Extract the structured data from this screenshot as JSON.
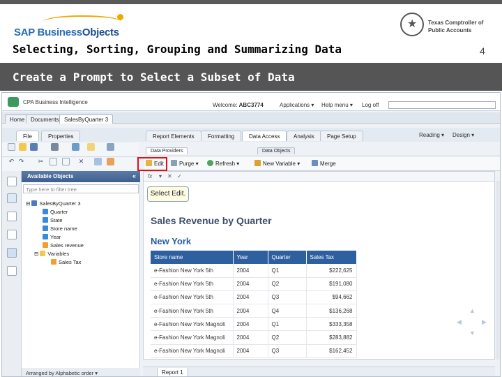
{
  "slide": {
    "logo_prefix": "SAP Business",
    "logo_suffix": "Objects",
    "org_line1": "Texas Comptroller of",
    "org_line2": "Public Accounts",
    "title": "Selecting, Sorting, Grouping and Summarizing Data",
    "page_number": "4",
    "banner": "Create a Prompt to Select a Subset of Data"
  },
  "app": {
    "title": "CPA Business Intelligence",
    "welcome_label": "Welcome:",
    "user": "ABC3774",
    "links": [
      "Applications ▾",
      "Help menu ▾",
      "Log off"
    ],
    "doc_tabs": [
      "Home",
      "Documents",
      "SalesByQuarter 3"
    ],
    "main_tabs": [
      "File",
      "Properties"
    ],
    "report_tabs": [
      "Report Elements",
      "Formatting",
      "Data Access",
      "Analysis",
      "Page Setup"
    ],
    "view_modes": [
      "Reading ▾",
      "Design ▾"
    ],
    "sub_tabs": [
      "Data Providers",
      "Data Objects"
    ],
    "ribbon": {
      "edit": "Edit",
      "purge": "Purge",
      "refresh": "Refresh",
      "new_variable": "New Variable",
      "merge": "Merge"
    },
    "callout": "Select Edit.",
    "panel": {
      "title": "Available Objects",
      "filter_placeholder": "Type here to filter tree",
      "tree": [
        "SalesByQuarter 3",
        "Quarter",
        "State",
        "Store name",
        "Year",
        "Sales revenue",
        "Variables",
        "Sales Tax"
      ],
      "footer": "Arranged by Alphabetic order ▾"
    },
    "report": {
      "title": "Sales Revenue by Quarter",
      "subtitle": "New York",
      "columns": [
        "Store name",
        "Year",
        "Quarter",
        "Sales Tax"
      ],
      "rows": [
        [
          "e-Fashion New York 5th",
          "2004",
          "Q1",
          "$222,625"
        ],
        [
          "e-Fashion New York 5th",
          "2004",
          "Q2",
          "$191,080"
        ],
        [
          "e-Fashion New York 5th",
          "2004",
          "Q3",
          "$94,662"
        ],
        [
          "e-Fashion New York 5th",
          "2004",
          "Q4",
          "$136,268"
        ],
        [
          "e-Fashion New York Magnoli",
          "2004",
          "Q1",
          "$333,358"
        ],
        [
          "e-Fashion New York Magnoli",
          "2004",
          "Q2",
          "$283,882"
        ],
        [
          "e-Fashion New York Magnoli",
          "2004",
          "Q3",
          "$162,452"
        ]
      ],
      "tab": "Report 1"
    }
  }
}
